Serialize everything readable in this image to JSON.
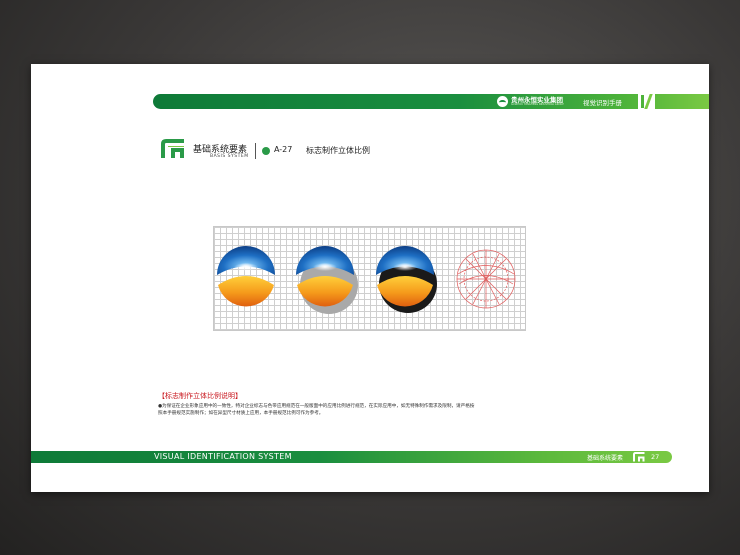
{
  "header": {
    "company_name": "贵州永恒实业集团",
    "company_name_en": "GUIZHOU YONGHENG INDUSTRIAL GROUP",
    "manual_title": "视觉识别手册",
    "band_color": "#1a8e3f"
  },
  "section": {
    "title_cn": "基础系统要素",
    "title_en": "BASIS SYSTEM",
    "code": "A-27",
    "title": "标志制作立体比例",
    "accent_color": "#2a9a48"
  },
  "figure": {
    "logo_variants": [
      "logo-flat",
      "logo-gray-shadow",
      "logo-black-shadow",
      "logo-construction"
    ],
    "blue": "#1e6fc4",
    "orange": "#f59a1b",
    "construction_color": "#e05a5a"
  },
  "note": {
    "title": "【标志制作立体比例说明】",
    "line1": "●为保证在企业形象应用中的一致性，特对企业标志与色带应用规范在一般版面中的应用比例进行规范，在实际应用中，如无特殊制作需求及限制，请严格按",
    "line2": "照本手册规范实施制作；如在异型尺寸材质上应用，本手册规范比例可作为参考。",
    "title_color": "#c8161d"
  },
  "footer": {
    "system_label": "VISUAL IDENTIFICATION SYSTEM",
    "section_label": "基础系统要素",
    "page_number": "27"
  }
}
